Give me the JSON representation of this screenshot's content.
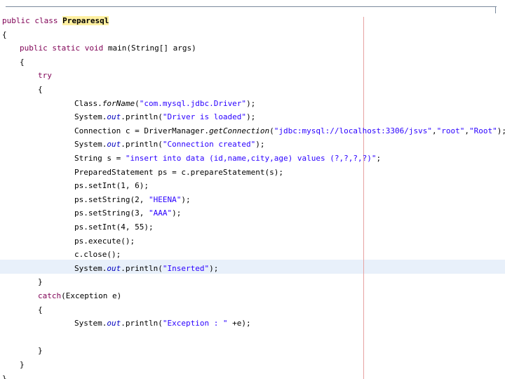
{
  "editor": {
    "lines": [
      {
        "indent": 0,
        "tokens": [
          {
            "t": "public",
            "c": "kw"
          },
          {
            "t": " "
          },
          {
            "t": "class",
            "c": "kw"
          },
          {
            "t": " "
          },
          {
            "t": "Preparesql",
            "c": "class-name"
          }
        ]
      },
      {
        "indent": 0,
        "tokens": [
          {
            "t": "{"
          }
        ]
      },
      {
        "indent": 1,
        "tokens": [
          {
            "t": "public",
            "c": "kw"
          },
          {
            "t": " "
          },
          {
            "t": "static",
            "c": "kw"
          },
          {
            "t": " "
          },
          {
            "t": "void",
            "c": "kw"
          },
          {
            "t": " main(String[] args)"
          }
        ]
      },
      {
        "indent": 1,
        "tokens": [
          {
            "t": "{"
          }
        ]
      },
      {
        "indent": 2,
        "tokens": [
          {
            "t": "try",
            "c": "kw"
          }
        ]
      },
      {
        "indent": 2,
        "tokens": [
          {
            "t": "{"
          }
        ]
      },
      {
        "indent": 3,
        "tokens": [
          {
            "t": "Class."
          },
          {
            "t": "forName",
            "c": "static-method"
          },
          {
            "t": "("
          },
          {
            "t": "\"com.mysql.jdbc.Driver\"",
            "c": "str"
          },
          {
            "t": ");"
          }
        ]
      },
      {
        "indent": 3,
        "tokens": [
          {
            "t": "System."
          },
          {
            "t": "out",
            "c": "static-field"
          },
          {
            "t": ".println("
          },
          {
            "t": "\"Driver is loaded\"",
            "c": "str"
          },
          {
            "t": ");"
          }
        ]
      },
      {
        "indent": 3,
        "tokens": [
          {
            "t": "Connection c = DriverManager."
          },
          {
            "t": "getConnection",
            "c": "static-method"
          },
          {
            "t": "("
          },
          {
            "t": "\"jdbc:mysql://localhost:3306/jsvs\"",
            "c": "str"
          },
          {
            "t": ","
          },
          {
            "t": "\"root\"",
            "c": "str"
          },
          {
            "t": ","
          },
          {
            "t": "\"Root\"",
            "c": "str"
          },
          {
            "t": ");"
          }
        ]
      },
      {
        "indent": 3,
        "tokens": [
          {
            "t": "System."
          },
          {
            "t": "out",
            "c": "static-field"
          },
          {
            "t": ".println("
          },
          {
            "t": "\"Connection created\"",
            "c": "str"
          },
          {
            "t": ");"
          }
        ]
      },
      {
        "indent": 3,
        "tokens": [
          {
            "t": "String s = "
          },
          {
            "t": "\"insert into data (id,name,city,age) values (?,?,?,?)\"",
            "c": "str"
          },
          {
            "t": ";"
          }
        ]
      },
      {
        "indent": 3,
        "tokens": [
          {
            "t": "PreparedStatement ps = c.prepareStatement(s);"
          }
        ]
      },
      {
        "indent": 3,
        "tokens": [
          {
            "t": "ps.setInt(1, 6);"
          }
        ]
      },
      {
        "indent": 3,
        "tokens": [
          {
            "t": "ps.setString(2, "
          },
          {
            "t": "\"HEENA\"",
            "c": "str"
          },
          {
            "t": ");"
          }
        ]
      },
      {
        "indent": 3,
        "tokens": [
          {
            "t": "ps.setString(3, "
          },
          {
            "t": "\"AAA\"",
            "c": "str"
          },
          {
            "t": ");"
          }
        ]
      },
      {
        "indent": 3,
        "tokens": [
          {
            "t": "ps.setInt(4, 55);"
          }
        ]
      },
      {
        "indent": 3,
        "tokens": [
          {
            "t": "ps.execute();"
          }
        ]
      },
      {
        "indent": 3,
        "tokens": [
          {
            "t": "c.close();"
          }
        ]
      },
      {
        "indent": 3,
        "tokens": [
          {
            "t": "System."
          },
          {
            "t": "out",
            "c": "static-field"
          },
          {
            "t": ".println("
          },
          {
            "t": "\"Inserted\"",
            "c": "str"
          },
          {
            "t": ");"
          }
        ]
      },
      {
        "indent": 2,
        "tokens": [
          {
            "t": "}"
          }
        ]
      },
      {
        "indent": 2,
        "tokens": [
          {
            "t": "catch",
            "c": "kw"
          },
          {
            "t": "(Exception e)"
          }
        ]
      },
      {
        "indent": 2,
        "tokens": [
          {
            "t": "{"
          }
        ]
      },
      {
        "indent": 3,
        "tokens": [
          {
            "t": "System."
          },
          {
            "t": "out",
            "c": "static-field"
          },
          {
            "t": ".println("
          },
          {
            "t": "\"Exception : \"",
            "c": "str"
          },
          {
            "t": " +e);"
          }
        ]
      },
      {
        "indent": 0,
        "tokens": []
      },
      {
        "indent": 2,
        "tokens": [
          {
            "t": "}"
          }
        ]
      },
      {
        "indent": 1,
        "tokens": [
          {
            "t": "}"
          }
        ]
      },
      {
        "indent": 0,
        "tokens": [
          {
            "t": "}"
          }
        ]
      }
    ]
  }
}
